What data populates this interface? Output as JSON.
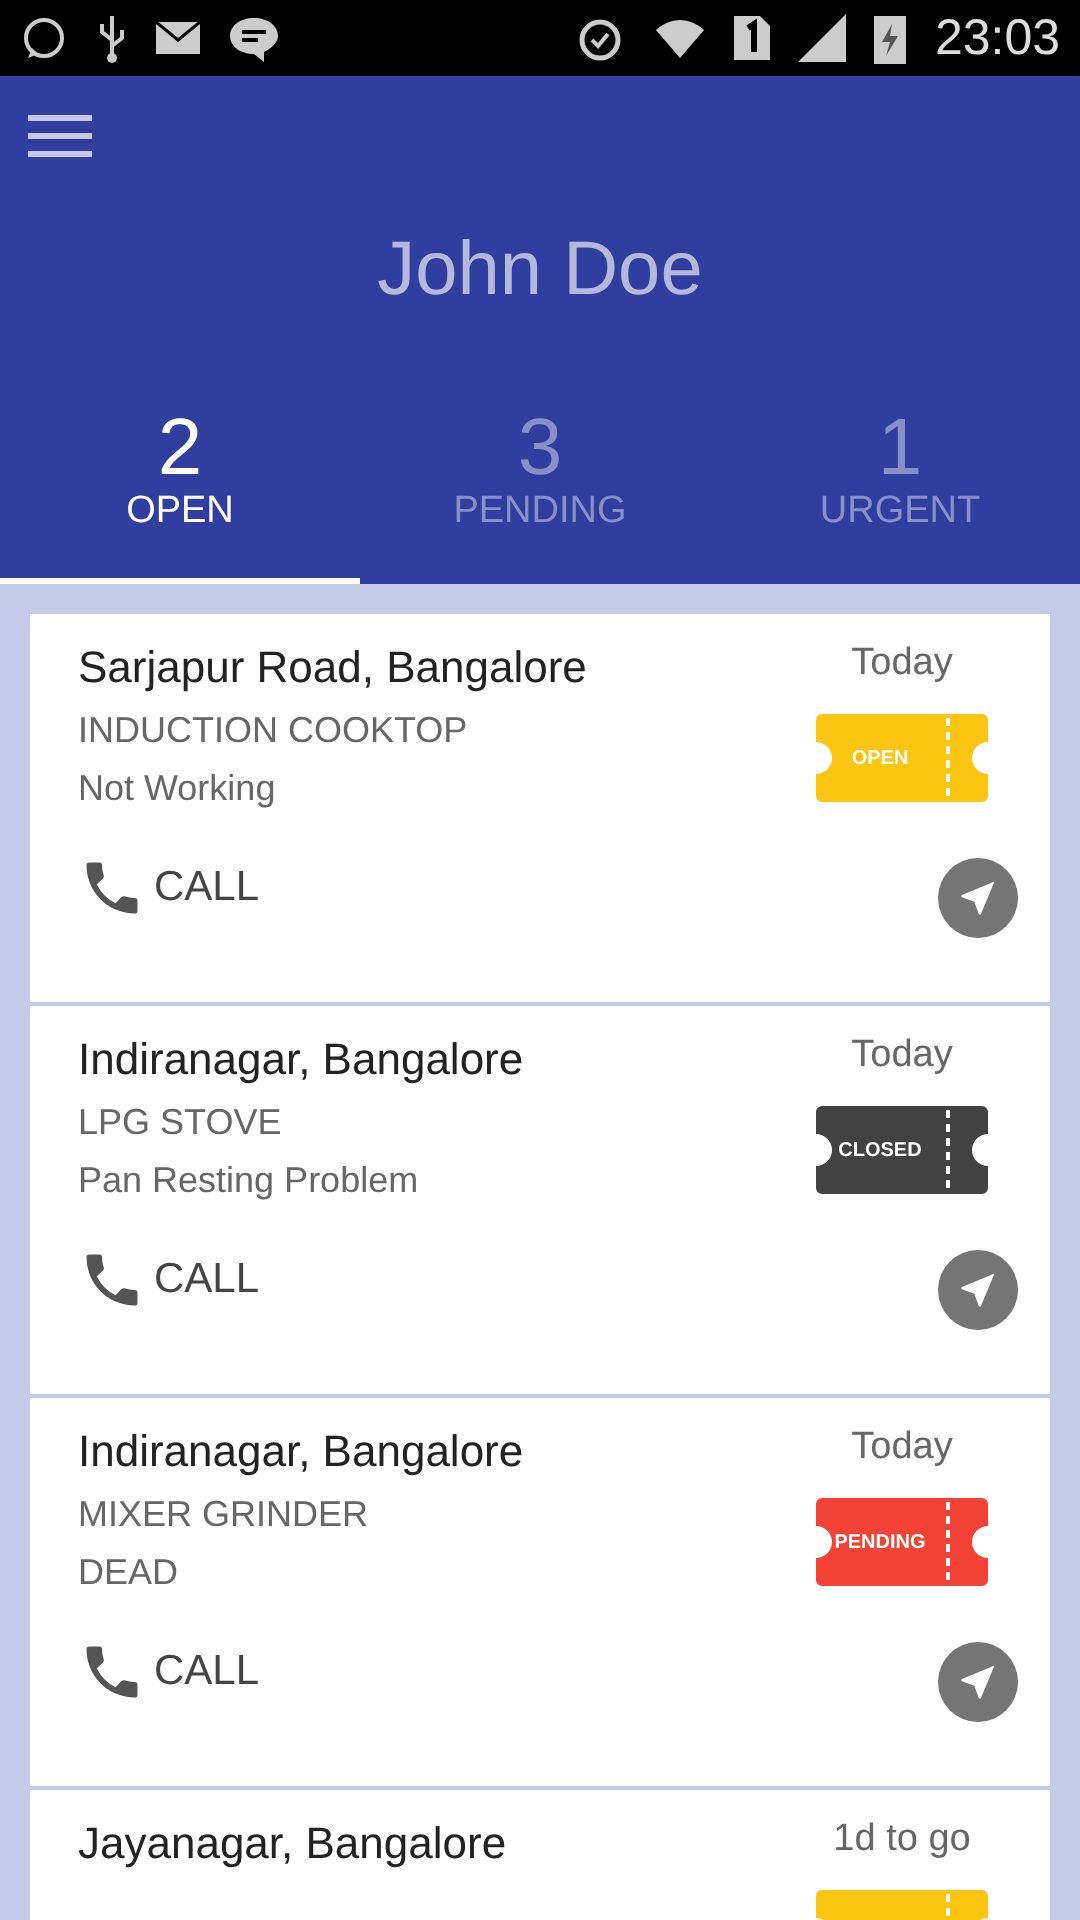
{
  "status_bar": {
    "time": "23:03"
  },
  "header": {
    "name": "John Doe"
  },
  "tabs": [
    {
      "count": "2",
      "label": "OPEN",
      "selected": true
    },
    {
      "count": "3",
      "label": "PENDING",
      "selected": false
    },
    {
      "count": "1",
      "label": "URGENT",
      "selected": false
    }
  ],
  "cards": [
    {
      "location": "Sarjapur Road, Bangalore",
      "product": "INDUCTION COOKTOP",
      "issue": "Not Working",
      "date": "Today",
      "status": "OPEN",
      "color": "#fbc512",
      "call": "CALL"
    },
    {
      "location": "Indiranagar, Bangalore",
      "product": "LPG STOVE",
      "issue": "Pan Resting Problem",
      "date": "Today",
      "status": "CLOSED",
      "color": "#424242",
      "call": "CALL"
    },
    {
      "location": "Indiranagar, Bangalore",
      "product": "MIXER GRINDER",
      "issue": "DEAD",
      "date": "Today",
      "status": "PENDING",
      "color": "#f44336",
      "call": "CALL"
    },
    {
      "location": "Jayanagar, Bangalore",
      "date": "1d to go",
      "color": "#fbc512"
    }
  ]
}
